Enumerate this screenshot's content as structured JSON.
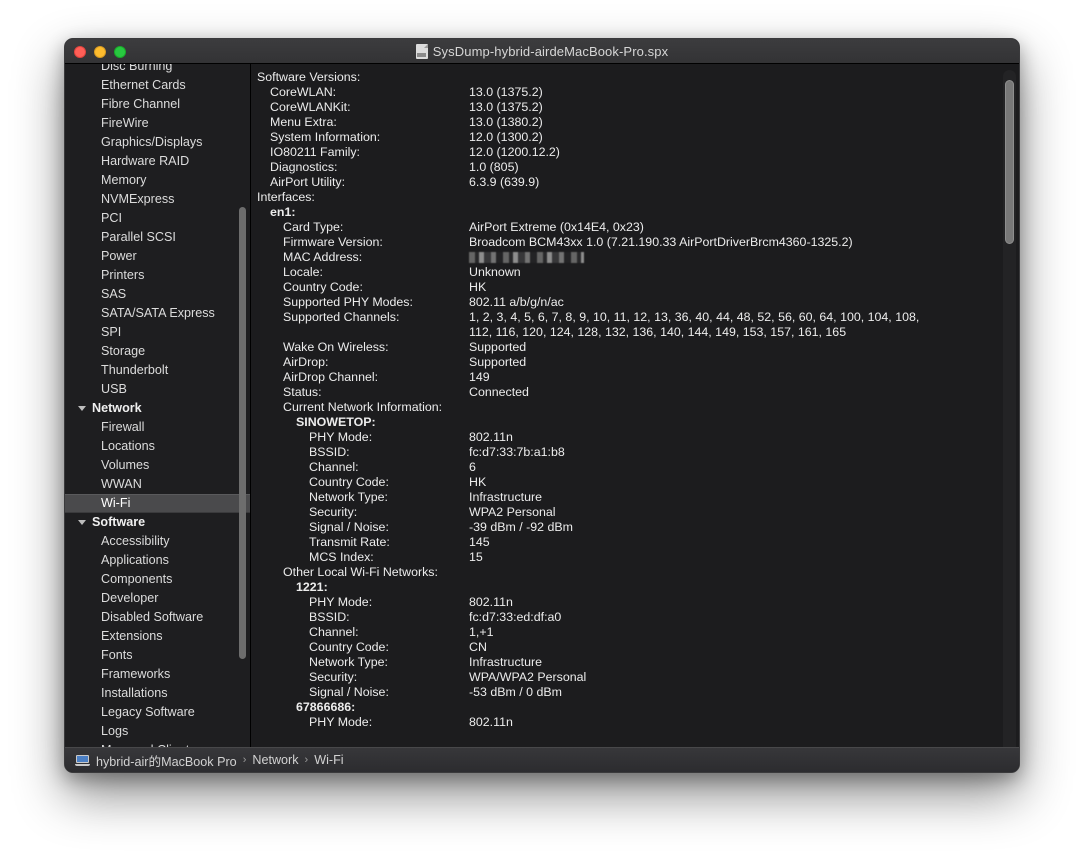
{
  "window": {
    "title": "SysDump-hybrid-airdeMacBook-Pro.spx",
    "doc_icon": "document-icon",
    "traffic": {
      "close": "close",
      "minimize": "minimize",
      "maximize": "maximize"
    }
  },
  "sidebar": {
    "items": [
      {
        "label": "Disc Burning",
        "type": "item",
        "partial": true
      },
      {
        "label": "Ethernet Cards",
        "type": "item"
      },
      {
        "label": "Fibre Channel",
        "type": "item"
      },
      {
        "label": "FireWire",
        "type": "item"
      },
      {
        "label": "Graphics/Displays",
        "type": "item"
      },
      {
        "label": "Hardware RAID",
        "type": "item"
      },
      {
        "label": "Memory",
        "type": "item"
      },
      {
        "label": "NVMExpress",
        "type": "item"
      },
      {
        "label": "PCI",
        "type": "item"
      },
      {
        "label": "Parallel SCSI",
        "type": "item"
      },
      {
        "label": "Power",
        "type": "item"
      },
      {
        "label": "Printers",
        "type": "item"
      },
      {
        "label": "SAS",
        "type": "item"
      },
      {
        "label": "SATA/SATA Express",
        "type": "item"
      },
      {
        "label": "SPI",
        "type": "item"
      },
      {
        "label": "Storage",
        "type": "item"
      },
      {
        "label": "Thunderbolt",
        "type": "item"
      },
      {
        "label": "USB",
        "type": "item"
      },
      {
        "label": "Network",
        "type": "group"
      },
      {
        "label": "Firewall",
        "type": "item"
      },
      {
        "label": "Locations",
        "type": "item"
      },
      {
        "label": "Volumes",
        "type": "item"
      },
      {
        "label": "WWAN",
        "type": "item"
      },
      {
        "label": "Wi-Fi",
        "type": "item",
        "selected": true
      },
      {
        "label": "Software",
        "type": "group"
      },
      {
        "label": "Accessibility",
        "type": "item"
      },
      {
        "label": "Applications",
        "type": "item"
      },
      {
        "label": "Components",
        "type": "item"
      },
      {
        "label": "Developer",
        "type": "item"
      },
      {
        "label": "Disabled Software",
        "type": "item"
      },
      {
        "label": "Extensions",
        "type": "item"
      },
      {
        "label": "Fonts",
        "type": "item"
      },
      {
        "label": "Frameworks",
        "type": "item"
      },
      {
        "label": "Installations",
        "type": "item"
      },
      {
        "label": "Legacy Software",
        "type": "item"
      },
      {
        "label": "Logs",
        "type": "item"
      },
      {
        "label": "Managed Client",
        "type": "item"
      }
    ]
  },
  "content": {
    "rows": [
      {
        "indent": 0,
        "label": "Software Versions:",
        "value": ""
      },
      {
        "indent": 1,
        "label": "CoreWLAN:",
        "value": "13.0 (1375.2)"
      },
      {
        "indent": 1,
        "label": "CoreWLANKit:",
        "value": "13.0 (1375.2)"
      },
      {
        "indent": 1,
        "label": "Menu Extra:",
        "value": "13.0 (1380.2)"
      },
      {
        "indent": 1,
        "label": "System Information:",
        "value": "12.0 (1300.2)"
      },
      {
        "indent": 1,
        "label": "IO80211 Family:",
        "value": "12.0 (1200.12.2)"
      },
      {
        "indent": 1,
        "label": "Diagnostics:",
        "value": "1.0 (805)"
      },
      {
        "indent": 1,
        "label": "AirPort Utility:",
        "value": "6.3.9 (639.9)"
      },
      {
        "indent": 0,
        "label": "Interfaces:",
        "value": ""
      },
      {
        "indent": 1,
        "label": "en1:",
        "value": "",
        "bold": true
      },
      {
        "indent": 2,
        "label": "Card Type:",
        "value": "AirPort Extreme  (0x14E4, 0x23)"
      },
      {
        "indent": 2,
        "label": "Firmware Version:",
        "value": "Broadcom BCM43xx 1.0 (7.21.190.33 AirPortDriverBrcm4360-1325.2)"
      },
      {
        "indent": 2,
        "label": "MAC Address:",
        "value": "",
        "redacted": true
      },
      {
        "indent": 2,
        "label": "Locale:",
        "value": "Unknown"
      },
      {
        "indent": 2,
        "label": "Country Code:",
        "value": "HK"
      },
      {
        "indent": 2,
        "label": "Supported PHY Modes:",
        "value": "802.11 a/b/g/n/ac"
      },
      {
        "indent": 2,
        "label": "Supported Channels:",
        "value": "1, 2, 3, 4, 5, 6, 7, 8, 9, 10, 11, 12, 13, 36, 40, 44, 48, 52, 56, 60, 64, 100, 104, 108,"
      },
      {
        "indent": 2,
        "label": "",
        "value": "112, 116, 120, 124, 128, 132, 136, 140, 144, 149, 153, 157, 161, 165"
      },
      {
        "indent": 2,
        "label": "Wake On Wireless:",
        "value": "Supported"
      },
      {
        "indent": 2,
        "label": "AirDrop:",
        "value": "Supported"
      },
      {
        "indent": 2,
        "label": "AirDrop Channel:",
        "value": "149"
      },
      {
        "indent": 2,
        "label": "Status:",
        "value": "Connected"
      },
      {
        "indent": 2,
        "label": "Current Network Information:",
        "value": ""
      },
      {
        "indent": 3,
        "label": "SINOWETOP:",
        "value": "",
        "bold": true
      },
      {
        "indent": 4,
        "label": "PHY Mode:",
        "value": "802.11n"
      },
      {
        "indent": 4,
        "label": "BSSID:",
        "value": "fc:d7:33:7b:a1:b8"
      },
      {
        "indent": 4,
        "label": "Channel:",
        "value": "6"
      },
      {
        "indent": 4,
        "label": "Country Code:",
        "value": "HK"
      },
      {
        "indent": 4,
        "label": "Network Type:",
        "value": "Infrastructure"
      },
      {
        "indent": 4,
        "label": "Security:",
        "value": "WPA2 Personal"
      },
      {
        "indent": 4,
        "label": "Signal / Noise:",
        "value": "-39 dBm / -92 dBm"
      },
      {
        "indent": 4,
        "label": "Transmit Rate:",
        "value": "145"
      },
      {
        "indent": 4,
        "label": "MCS Index:",
        "value": "15"
      },
      {
        "indent": 2,
        "label": "Other Local Wi-Fi Networks:",
        "value": ""
      },
      {
        "indent": 3,
        "label": "1221:",
        "value": "",
        "bold": true
      },
      {
        "indent": 4,
        "label": "PHY Mode:",
        "value": "802.11n"
      },
      {
        "indent": 4,
        "label": "BSSID:",
        "value": "fc:d7:33:ed:df:a0"
      },
      {
        "indent": 4,
        "label": "Channel:",
        "value": "1,+1"
      },
      {
        "indent": 4,
        "label": "Country Code:",
        "value": "CN"
      },
      {
        "indent": 4,
        "label": "Network Type:",
        "value": "Infrastructure"
      },
      {
        "indent": 4,
        "label": "Security:",
        "value": "WPA/WPA2 Personal"
      },
      {
        "indent": 4,
        "label": "Signal / Noise:",
        "value": "-53 dBm / 0 dBm"
      },
      {
        "indent": 3,
        "label": "67866686:",
        "value": "",
        "bold": true
      },
      {
        "indent": 4,
        "label": "PHY Mode:",
        "value": "802.11n"
      }
    ]
  },
  "statusbar": {
    "machine_icon": "macbook-icon",
    "crumbs": [
      "hybrid-air的MacBook Pro",
      "Network",
      "Wi-Fi"
    ],
    "separator": "›"
  },
  "colors": {
    "window_bg": "#1c1c1e",
    "sidebar_bg": "#1e1e20",
    "selection": "#4a4a4c",
    "text": "#ececec",
    "titlebar": "#3c3c3e"
  }
}
